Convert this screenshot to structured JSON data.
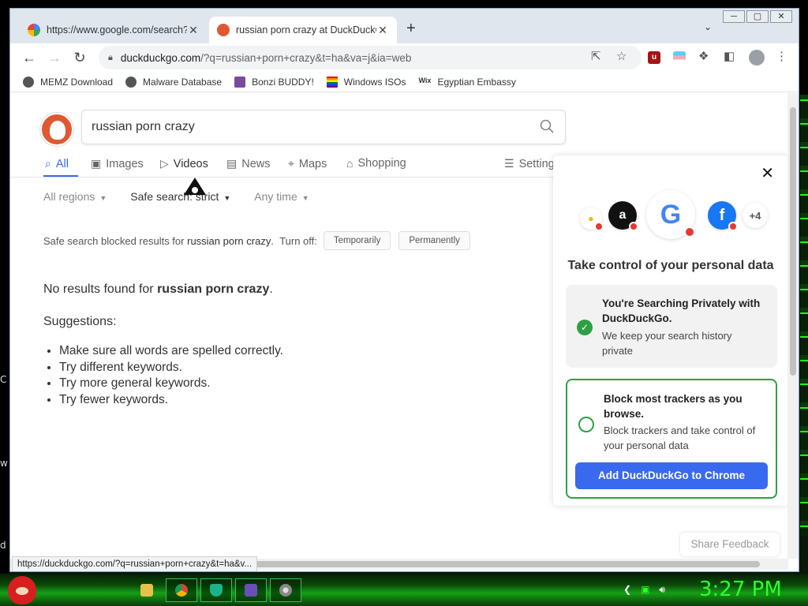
{
  "browser": {
    "tabs": [
      {
        "title": "https://www.google.com/search?",
        "close": "✕"
      },
      {
        "title": "russian porn crazy at DuckDuckGo",
        "close": "✕"
      }
    ],
    "new_tab": "+",
    "window_controls": [
      "─",
      "▢",
      "✕"
    ],
    "url_domain": "duckduckgo.com",
    "url_rest": "/?q=russian+porn+crazy&t=ha&va=j&ia=web",
    "bookmarks": [
      "MEMZ Download",
      "Malware Database",
      "Bonzi BUDDY!",
      "Windows ISOs",
      "Egyptian Embassy"
    ],
    "status_url": "https://duckduckgo.com/?q=russian+porn+crazy&t=ha&v..."
  },
  "search": {
    "query": "russian porn crazy"
  },
  "nav": {
    "tabs": [
      "All",
      "Images",
      "Videos",
      "News",
      "Maps",
      "Shopping"
    ],
    "settings": "Settings"
  },
  "filters": {
    "region": "All regions",
    "safe_search": "Safe search: strict",
    "time": "Any time"
  },
  "safe_search_notice": {
    "prefix": "Safe search blocked results for",
    "query": "russian porn crazy",
    "suffix": ".",
    "turn_off": "Turn off:",
    "temporarily": "Temporarily",
    "permanently": "Permanently"
  },
  "results": {
    "no_results_prefix": "No results found for",
    "query": "russian porn crazy",
    "suffix": ".",
    "suggestions_title": "Suggestions:",
    "suggestions": [
      "Make sure all words are spelled correctly.",
      "Try different keywords.",
      "Try more general keywords.",
      "Try fewer keywords."
    ]
  },
  "panel": {
    "close": "✕",
    "more_count": "+4",
    "title": "Take control of your personal data",
    "card1_heading": "You're Searching Privately with DuckDuckGo.",
    "card1_sub": "We keep your search history private",
    "card2_heading": "Block most trackers as you browse.",
    "card2_sub": "Block trackers and take control of your personal data",
    "cta": "Add DuckDuckGo to Chrome"
  },
  "feedback": "Share Feedback",
  "desktop": {
    "left_chars": [
      "C",
      "w",
      "d"
    ]
  },
  "taskbar": {
    "clock": "3:27 PM"
  },
  "colors": {
    "ddg_blue": "#3969ef",
    "ddg_orange": "#de5833",
    "green": "#2ea043",
    "clock_green": "#2bff2b"
  }
}
